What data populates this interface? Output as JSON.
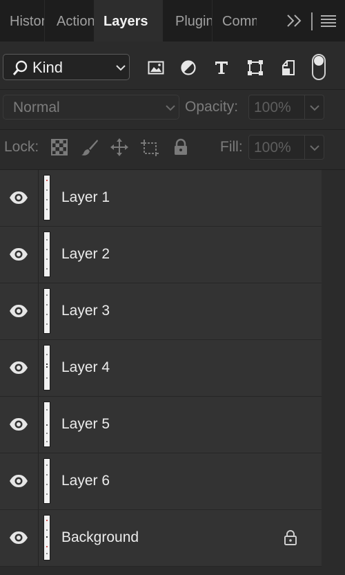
{
  "tabs": [
    {
      "label": "History"
    },
    {
      "label": "Actions"
    },
    {
      "label": "Layers"
    },
    {
      "label": "Plugins"
    },
    {
      "label": "Comments"
    }
  ],
  "filter": {
    "kind_label": "Kind"
  },
  "blend": {
    "mode": "Normal",
    "opacity_label": "Opacity:",
    "opacity_value": "100%"
  },
  "lock_row": {
    "lock_label": "Lock:",
    "fill_label": "Fill:",
    "fill_value": "100%"
  },
  "layers": [
    {
      "name": "Layer 1",
      "visible": true,
      "locked": false
    },
    {
      "name": "Layer 2",
      "visible": true,
      "locked": false
    },
    {
      "name": "Layer 3",
      "visible": true,
      "locked": false
    },
    {
      "name": "Layer 4",
      "visible": true,
      "locked": false
    },
    {
      "name": "Layer 5",
      "visible": true,
      "locked": false
    },
    {
      "name": "Layer 6",
      "visible": true,
      "locked": false
    },
    {
      "name": "Background",
      "visible": true,
      "locked": true
    }
  ],
  "colors": {
    "panel_bg": "#2b2b2b",
    "tabbar_bg": "#1d1d1d",
    "row_bg": "#333333",
    "text": "#ececec",
    "dim_text": "#7c7c7c"
  }
}
